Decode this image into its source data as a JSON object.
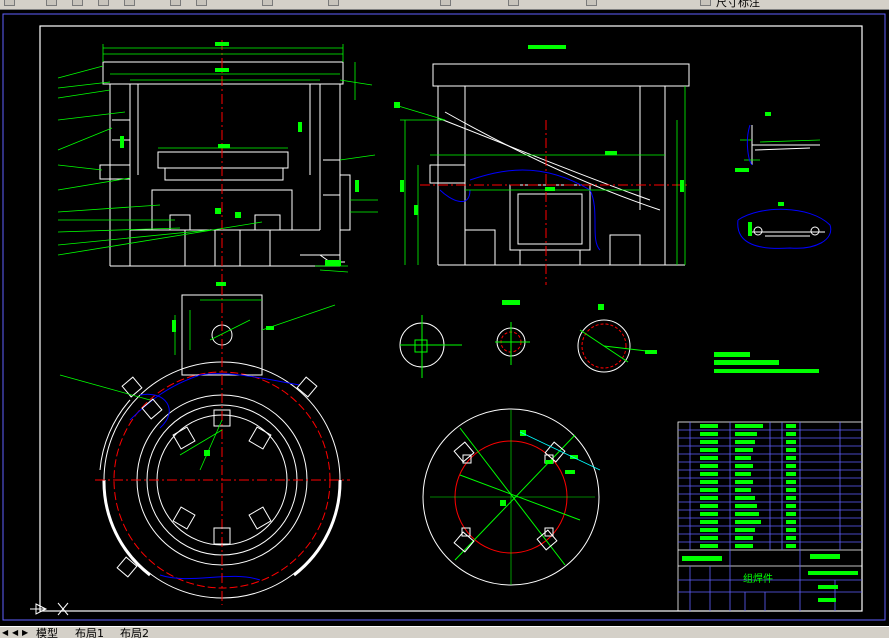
{
  "toolbar": {
    "layer_name": "尺寸标注",
    "icons": [
      "save-icon",
      "open-icon",
      "print-icon",
      "undo-icon",
      "redo-icon",
      "pan-icon",
      "zoom-icon",
      "zoom-previous-icon",
      "text-style-icon",
      "dim-style-icon",
      "properties-icon",
      "layer-icon"
    ]
  },
  "tabs": [
    "模型",
    "布局1",
    "布局2"
  ],
  "drawing": {
    "title_block_name": "组焊件",
    "colors": {
      "background": "#000000",
      "frame": "#ffffff",
      "dimension": "#00ff00",
      "centerline": "#ff0000",
      "hidden": "#0000ff",
      "revision": "#00ffff",
      "cursor": "#ffffff"
    }
  }
}
